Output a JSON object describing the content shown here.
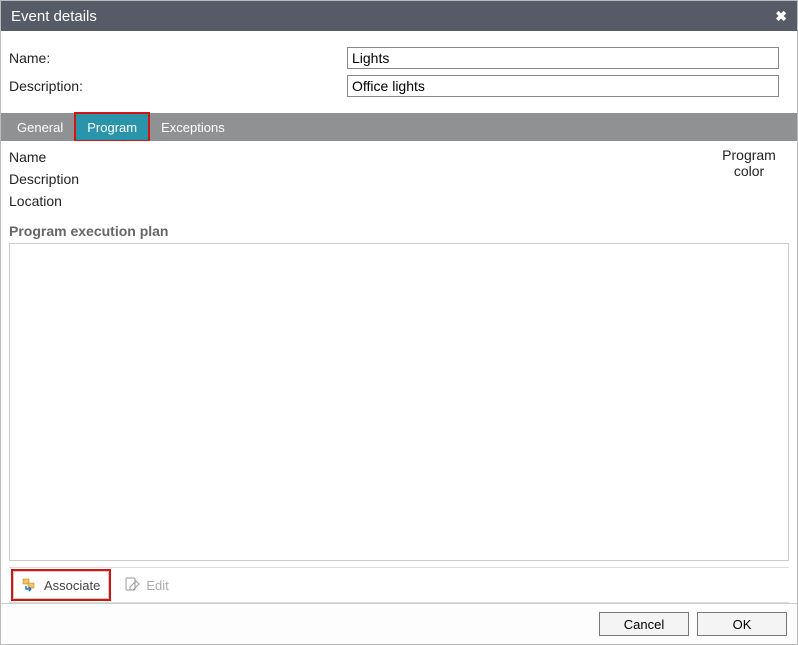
{
  "window": {
    "title": "Event details",
    "close_glyph": "✖"
  },
  "form": {
    "name_label": "Name:",
    "name_value": "Lights",
    "description_label": "Description:",
    "description_value": "Office lights"
  },
  "tabs": {
    "general": "General",
    "program": "Program",
    "exceptions": "Exceptions",
    "active": "program",
    "highlighted": "program"
  },
  "program": {
    "name_label": "Name",
    "description_label": "Description",
    "location_label": "Location",
    "program_color_label": "Program color",
    "plan_header": "Program execution plan"
  },
  "toolbar": {
    "associate_label": "Associate",
    "edit_label": "Edit",
    "highlighted": "associate"
  },
  "buttons": {
    "cancel": "Cancel",
    "ok": "OK"
  }
}
